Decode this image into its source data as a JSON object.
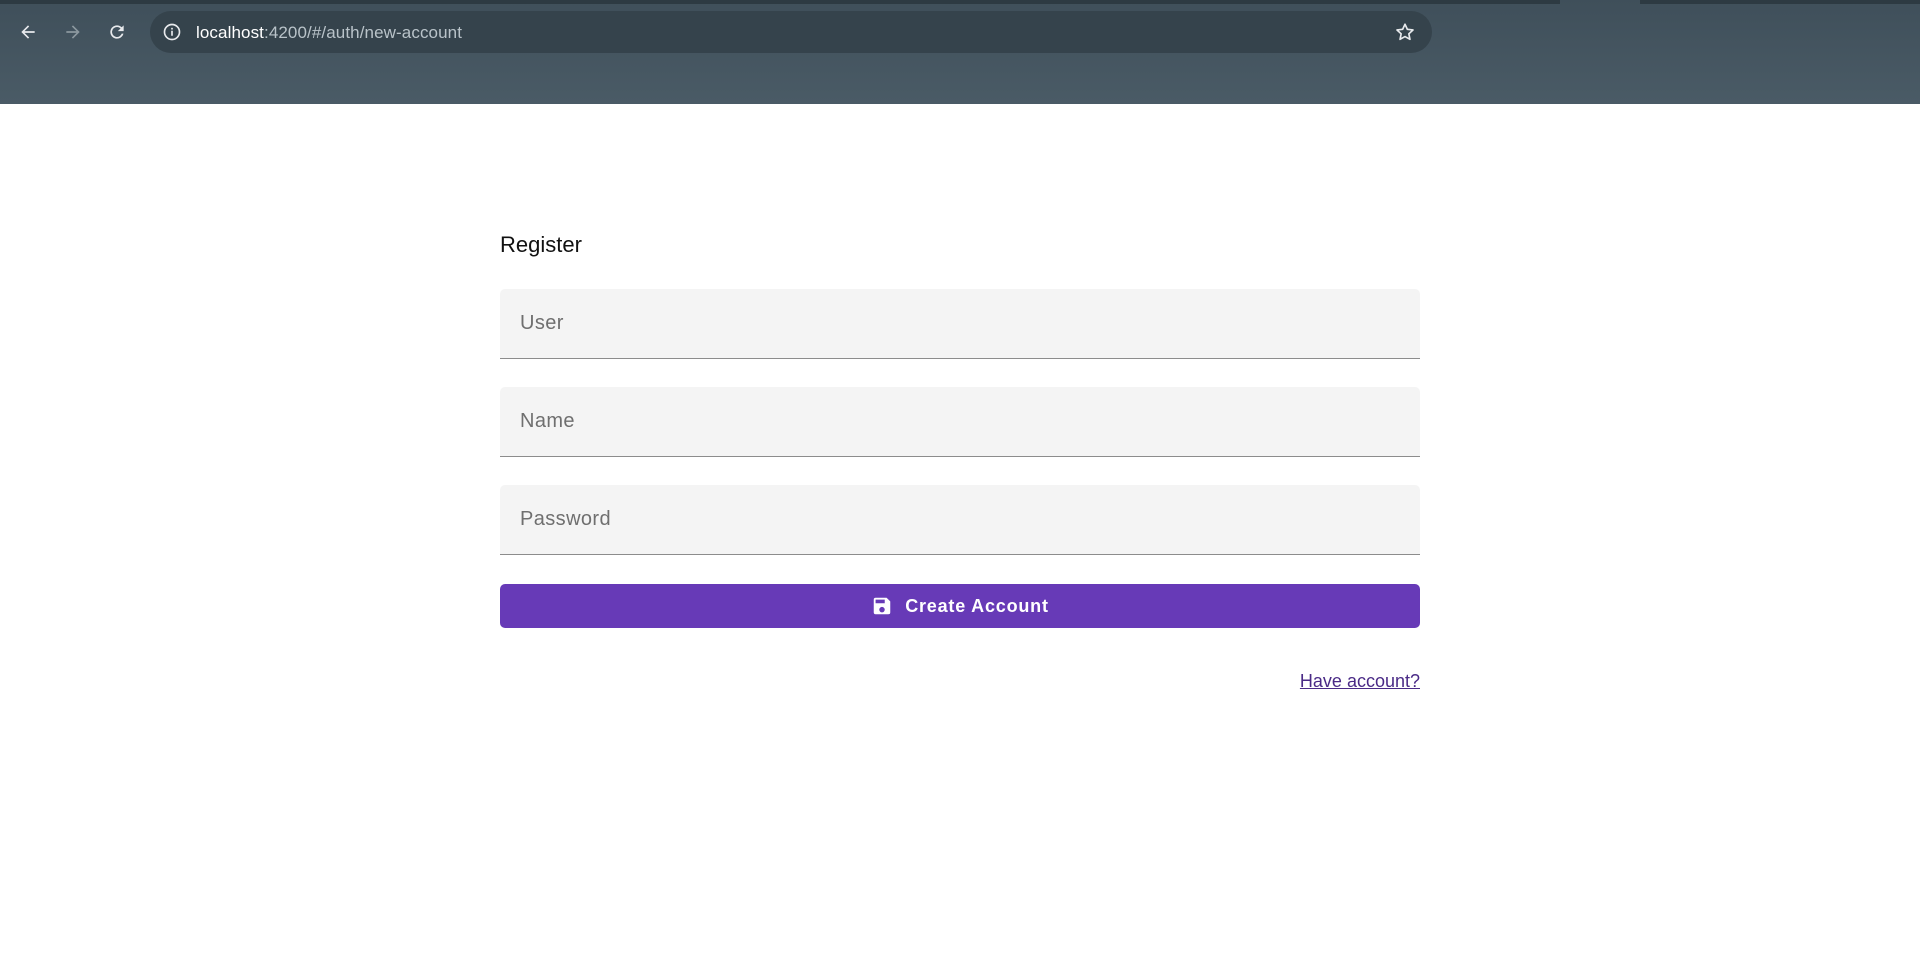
{
  "browser": {
    "url_host": "localhost",
    "url_rest": ":4200/#/auth/new-account",
    "icons": [
      "back-arrow-icon",
      "forward-arrow-icon",
      "reload-icon",
      "site-info-icon",
      "bookmark-star-icon"
    ]
  },
  "form": {
    "title": "Register",
    "fields": {
      "user": {
        "placeholder": "User",
        "value": ""
      },
      "name": {
        "placeholder": "Name",
        "value": ""
      },
      "password": {
        "placeholder": "Password",
        "value": ""
      }
    },
    "submit_label": "Create Account",
    "submit_icon": "save-icon",
    "login_link": "Have account?"
  },
  "colors": {
    "accent": "#673ab7",
    "browser_frame": "#45545e",
    "omnibox": "#35434c",
    "field_bg": "#f4f4f4",
    "link": "#4a2a86"
  }
}
